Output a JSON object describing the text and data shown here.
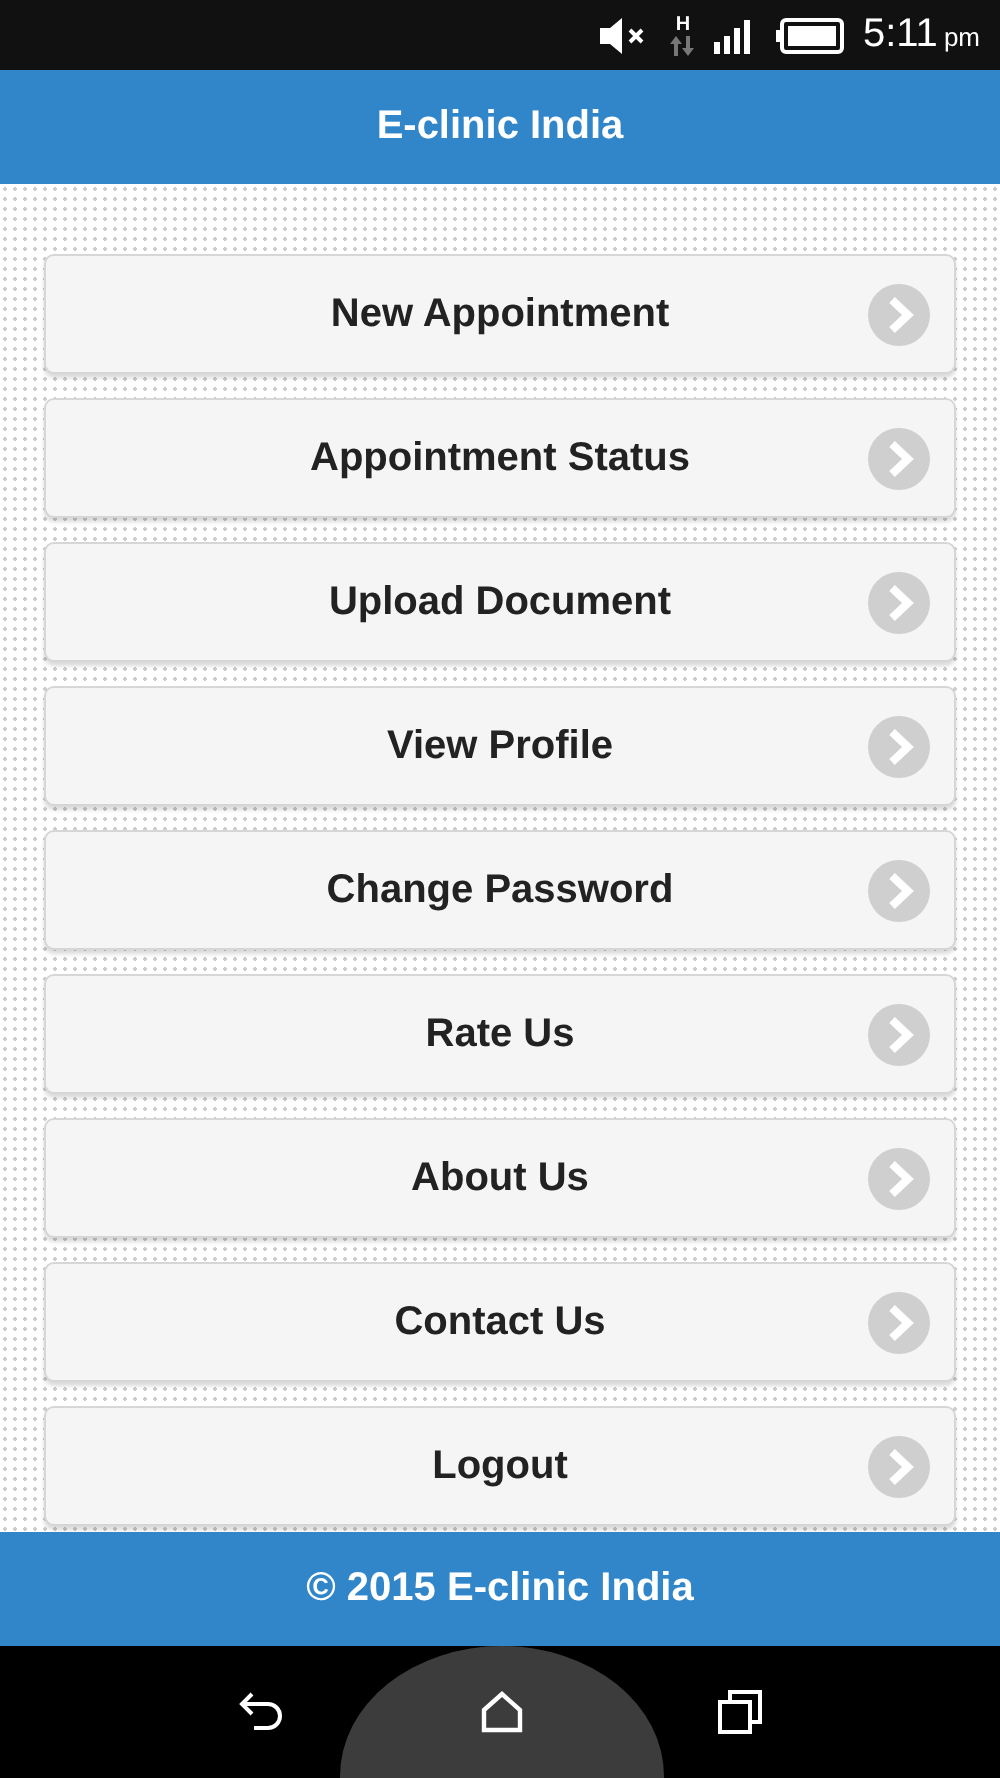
{
  "status_bar": {
    "network_type": "H",
    "time": "5:11",
    "meridiem": "pm"
  },
  "header": {
    "title": "E-clinic India"
  },
  "menu": [
    {
      "label": "New Appointment"
    },
    {
      "label": "Appointment Status"
    },
    {
      "label": "Upload Document"
    },
    {
      "label": "View Profile"
    },
    {
      "label": "Change Password"
    },
    {
      "label": "Rate Us"
    },
    {
      "label": "About Us"
    },
    {
      "label": "Contact Us"
    },
    {
      "label": "Logout"
    }
  ],
  "footer": {
    "text": "© 2015 E-clinic India"
  }
}
